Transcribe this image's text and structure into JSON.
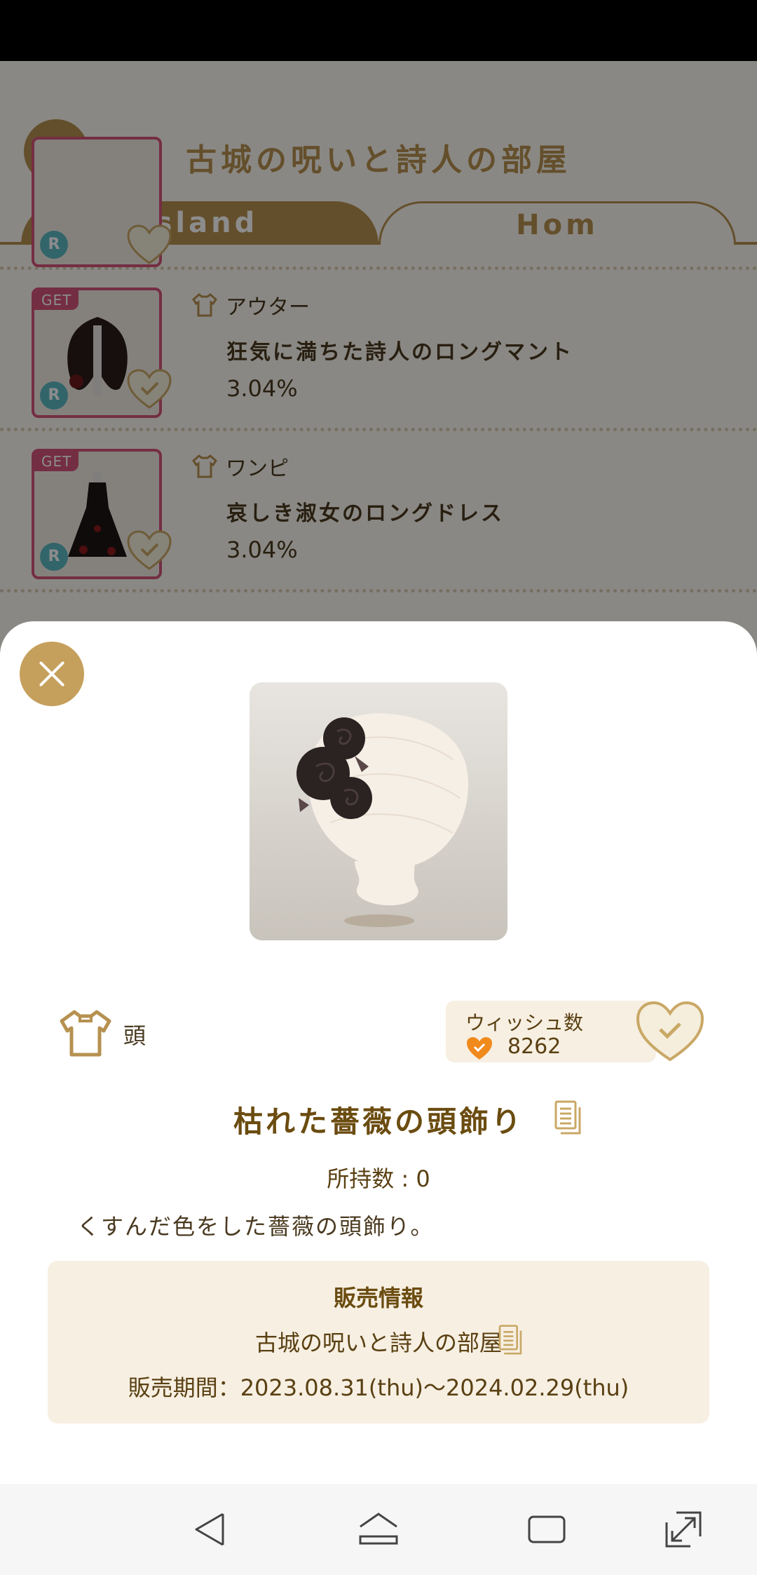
{
  "background": {
    "title": "古城の呪いと詩人の部屋",
    "tabs": [
      {
        "label": "Island"
      },
      {
        "label": "Hom"
      }
    ],
    "items": [
      {
        "badge": "GET",
        "rarity": "R",
        "category": "アウター",
        "name": "狂気に満ちた詩人のロングマント",
        "rate": "3.04%"
      },
      {
        "badge": "GET",
        "rarity": "R",
        "category": "ワンピ",
        "name": "哀しき淑女のロングドレス",
        "rate": "3.04%"
      }
    ]
  },
  "sheet": {
    "category": "頭",
    "wish": {
      "label": "ウィッシュ数",
      "count": "8262"
    },
    "item_name": "枯れた薔薇の頭飾り",
    "owned": "所持数 : 0",
    "description": "くすんだ色をした薔薇の頭飾り。",
    "sale": {
      "heading": "販売情報",
      "source": "古城の呪いと詩人の部屋",
      "period": "販売期間：2023.08.31(thu)〜2024.02.29(thu)"
    }
  },
  "colors": {
    "accent": "#b69150",
    "badge": "#d4547b",
    "rarity": "#5bb8c2",
    "wish_heart": "#f08a1c"
  },
  "icons": [
    "close-icon",
    "shirt-icon",
    "heart-check-icon",
    "document-icon",
    "back-icon",
    "home-icon",
    "recents-icon",
    "expand-icon"
  ]
}
